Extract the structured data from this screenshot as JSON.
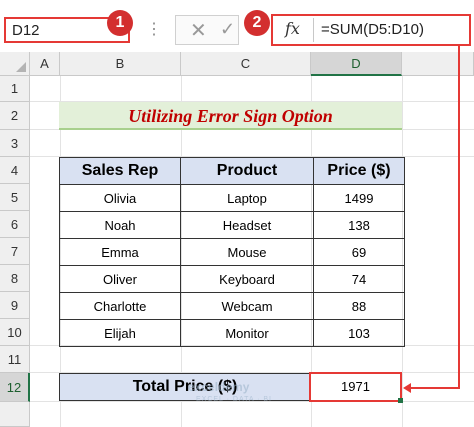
{
  "name_box": {
    "value": "D12"
  },
  "formula_bar": {
    "fx_label": "fx",
    "formula": "=SUM(D5:D10)",
    "cancel_glyph": "✕",
    "enter_glyph": "✓"
  },
  "callouts": {
    "namebox_marker": "1",
    "formula_marker": "2"
  },
  "columns": [
    "A",
    "B",
    "C",
    "D"
  ],
  "rows": [
    "1",
    "2",
    "3",
    "4",
    "5",
    "6",
    "7",
    "8",
    "9",
    "10",
    "11",
    "12"
  ],
  "selected": {
    "column": "D",
    "row": "12"
  },
  "sheet": {
    "title": "Utilizing Error Sign Option",
    "headers": [
      "Sales Rep",
      "Product",
      "Price ($)"
    ],
    "data": [
      [
        "Olivia",
        "Laptop",
        "1499"
      ],
      [
        "Noah",
        "Headset",
        "138"
      ],
      [
        "Emma",
        "Mouse",
        "69"
      ],
      [
        "Oliver",
        "Keyboard",
        "74"
      ],
      [
        "Charlotte",
        "Webcam",
        "88"
      ],
      [
        "Elijah",
        "Monitor",
        "103"
      ]
    ],
    "total_label": "Total Price ($)",
    "total_value": "1971"
  },
  "watermark": {
    "brand": "exceldemy",
    "tagline": "EXCEL · DATA · BI"
  },
  "colors": {
    "accent_red": "#e53935",
    "badge_red": "#d32f2f",
    "header_fill": "#d9e1f2",
    "title_fill": "#e3f0d9",
    "title_text": "#c00000",
    "excel_green": "#217346"
  },
  "icons": {
    "cancel": "cancel-icon",
    "enter": "enter-icon",
    "fx": "fx-icon",
    "dropdown": "dropdown-caret-icon"
  }
}
